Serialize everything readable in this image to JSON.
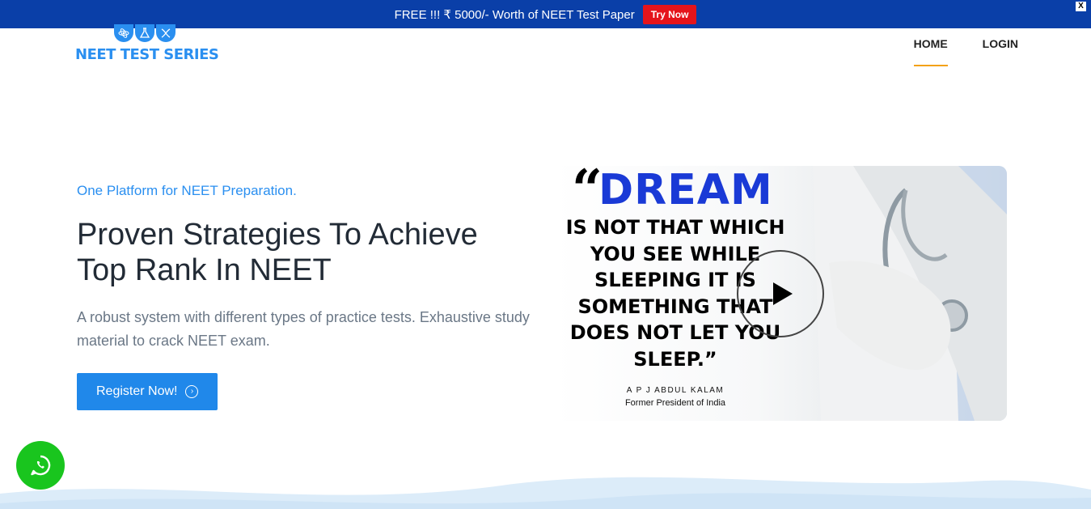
{
  "announcement": {
    "text": "FREE !!! ₹ 5000/- Worth of NEET Test Paper",
    "cta_label": "Try Now",
    "close_label": "X"
  },
  "logo": {
    "text": "NEET TEST SERIES"
  },
  "nav": {
    "items": [
      {
        "label": "HOME"
      },
      {
        "label": "LOGIN"
      }
    ]
  },
  "hero": {
    "tagline": "One Platform for NEET Preparation.",
    "headline_line1": "Proven Strategies To Achieve",
    "headline_line2": "Top Rank In NEET",
    "description": "A robust system with different types of practice tests. Exhaustive study material to crack NEET exam.",
    "register_label": "Register Now!"
  },
  "video": {
    "quote_open": "“",
    "quote_word": "DREAM",
    "quote_lines": [
      "IS NOT THAT WHICH",
      "YOU SEE WHILE",
      "SLEEPING IT IS",
      "SOMETHING THAT",
      "DOES NOT LET YOU",
      "SLEEP.”"
    ],
    "author": "A P J ABDUL KALAM",
    "author_title": "Former President of India"
  },
  "colors": {
    "topbar": "#0a3fa8",
    "accent": "#2a8ff0",
    "cta_red": "#e5141b",
    "nav_underline": "#f3a218",
    "whatsapp": "#19c51e"
  },
  "icons": {
    "register": "chevron-circle-right-icon",
    "video": "play-icon",
    "chat": "whatsapp-icon"
  }
}
